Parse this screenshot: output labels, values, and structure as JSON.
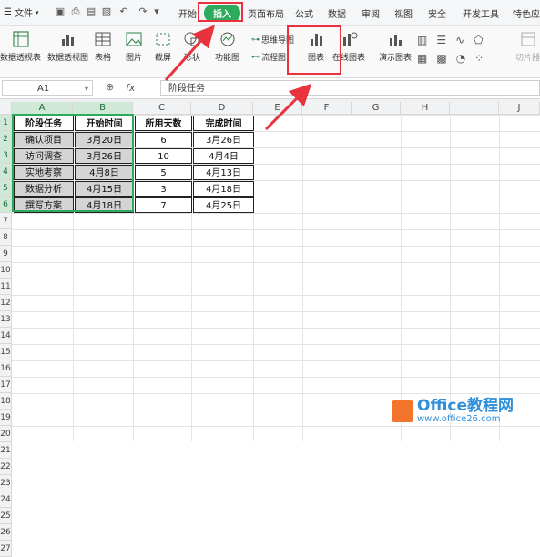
{
  "menubar": {
    "file_label": "文件",
    "tabs": [
      "开始",
      "插入",
      "页面布局",
      "公式",
      "数据",
      "审阅",
      "视图",
      "安全",
      "开发工具",
      "特色应"
    ],
    "active_tab": "插入"
  },
  "ribbon": {
    "pivot_table": "数据透视表",
    "pivot_chart": "数据透视图",
    "table": "表格",
    "picture": "图片",
    "screenshot": "截屏",
    "shape": "形状",
    "function_chart": "功能图",
    "mind_map": "思维导图",
    "flowchart": "流程图",
    "chart": "图表",
    "online_chart": "在线图表",
    "demo_chart": "演示图表",
    "slicer": "切片器"
  },
  "formula_bar": {
    "cell_ref": "A1",
    "fx": "fx",
    "content": "阶段任务"
  },
  "columns": [
    "A",
    "B",
    "C",
    "D",
    "E",
    "F",
    "G",
    "H",
    "I",
    "J"
  ],
  "rows": [
    "1",
    "2",
    "3",
    "4",
    "5",
    "6",
    "7",
    "8",
    "9",
    "10",
    "11",
    "12",
    "13",
    "14",
    "15",
    "16",
    "17",
    "18",
    "19",
    "20",
    "21",
    "22",
    "23",
    "24",
    "25",
    "26",
    "27"
  ],
  "sheet": {
    "headers": [
      "阶段任务",
      "开始时间",
      "所用天数",
      "完成时间"
    ],
    "data": [
      [
        "确认项目",
        "3月20日",
        "6",
        "3月26日"
      ],
      [
        "访问调查",
        "3月26日",
        "10",
        "4月4日"
      ],
      [
        "实地考察",
        "4月8日",
        "5",
        "4月13日"
      ],
      [
        "数据分析",
        "4月15日",
        "3",
        "4月18日"
      ],
      [
        "撰写方案",
        "4月18日",
        "7",
        "4月25日"
      ]
    ]
  },
  "watermark": {
    "title": "Office教程网",
    "url": "www.office26.com"
  }
}
